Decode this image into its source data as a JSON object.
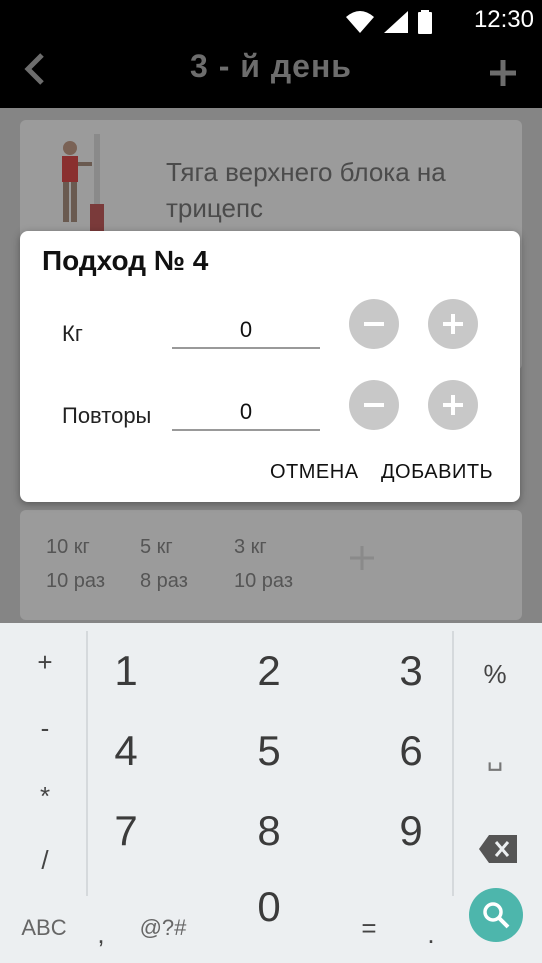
{
  "status_bar": {
    "time": "12:30"
  },
  "app_bar": {
    "title": "3 - й день",
    "back_icon": "chevron-left-icon",
    "add_icon": "plus-icon"
  },
  "exercise": {
    "title": "Тяга верхнего блока на трицепс"
  },
  "sets": [
    {
      "weight": "10 кг",
      "reps": "10 раз"
    },
    {
      "weight": "5 кг",
      "reps": "8 раз"
    },
    {
      "weight": "3 кг",
      "reps": "10 раз"
    }
  ],
  "dialog": {
    "title": "Подход  № 4",
    "weight_label": "Кг",
    "weight_value": "0",
    "reps_label": "Повторы",
    "reps_value": "0",
    "cancel_label": "ОТМЕНА",
    "add_label": "ДОБАВИТЬ"
  },
  "keyboard": {
    "left_column": [
      "+",
      "-",
      "*",
      "/"
    ],
    "digits": [
      "1",
      "2",
      "3",
      "4",
      "5",
      "6",
      "7",
      "8",
      "9",
      "0"
    ],
    "right_column": [
      "%",
      "␣"
    ],
    "bottom_row": {
      "abc": "ABC",
      "comma": ",",
      "symbols": "@?#",
      "equals": "=",
      "dot": "."
    }
  },
  "colors": {
    "accent_teal": "#4db6ac",
    "overlay": "#858585",
    "dialog_bg": "#ffffff"
  }
}
